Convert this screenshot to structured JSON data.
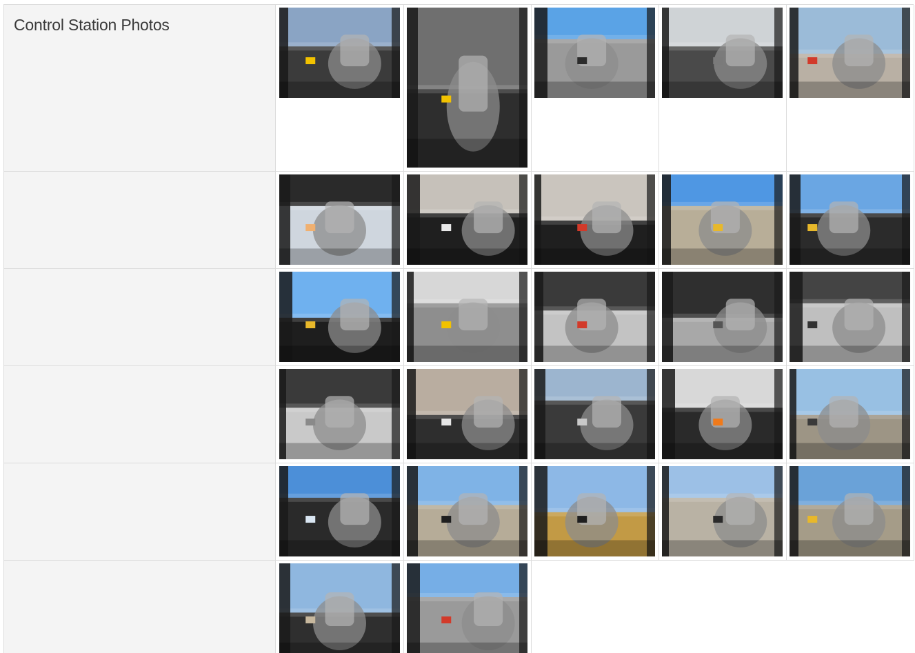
{
  "section": {
    "title": "Control Station Photos"
  },
  "rows": [
    {
      "photos": [
        {
          "icon": "cab-floor-photo",
          "sky": "#8aa4c4",
          "ground": "#3b3b3b",
          "accent": "#f2c200"
        },
        {
          "icon": "cab-floor-pedals-photo",
          "sky": "#6f6f6f",
          "ground": "#2e2e2e",
          "accent": "#f2c200"
        },
        {
          "icon": "operator-seat-photo",
          "sky": "#5aa3e6",
          "ground": "#9a9a9a",
          "accent": "#2b2b2b"
        },
        {
          "icon": "operator-seat-top-photo",
          "sky": "#cfd3d6",
          "ground": "#4a4a4a",
          "accent": "#7a7a7a"
        },
        {
          "icon": "joystick-lever-photo",
          "sky": "#9bbbd8",
          "ground": "#b9b0a4",
          "accent": "#d23a2a"
        }
      ]
    },
    {
      "photos": [
        {
          "icon": "cab-ceiling-light-photo",
          "sky": "#2a2a2a",
          "ground": "#cfd6de",
          "accent": "#f0b070"
        },
        {
          "icon": "ceiling-speaker-photo",
          "sky": "#c6c1ba",
          "ground": "#1f1f1f",
          "accent": "#e9e9e9"
        },
        {
          "icon": "ceiling-speaker-photo",
          "sky": "#cac5be",
          "ground": "#1f1f1f",
          "accent": "#d23a2a"
        },
        {
          "icon": "rear-window-view-photo",
          "sky": "#4f97e3",
          "ground": "#b8ae98",
          "accent": "#e8b82a"
        },
        {
          "icon": "rear-window-view-photo",
          "sky": "#6aa6e3",
          "ground": "#2b2b2b",
          "accent": "#e8b82a"
        }
      ]
    },
    {
      "photos": [
        {
          "icon": "front-window-view-photo",
          "sky": "#6fb1ef",
          "ground": "#1e1e1e",
          "accent": "#e8b82a"
        },
        {
          "icon": "climate-control-panel-photo",
          "sky": "#d7d7d7",
          "ground": "#8e8e8e",
          "accent": "#f2c200"
        },
        {
          "icon": "right-console-photo",
          "sky": "#3a3a3a",
          "ground": "#c3c3c3",
          "accent": "#d23a2a"
        },
        {
          "icon": "shift-lever-photo",
          "sky": "#2f2f2f",
          "ground": "#a8a8a8",
          "accent": "#555555"
        },
        {
          "icon": "joystick-console-photo",
          "sky": "#444444",
          "ground": "#bfbfbf",
          "accent": "#333333"
        }
      ]
    },
    {
      "photos": [
        {
          "icon": "cup-holder-photo",
          "sky": "#3a3a3a",
          "ground": "#c9c9c9",
          "accent": "#8a8a8a"
        },
        {
          "icon": "air-vent-photo",
          "sky": "#b9ada0",
          "ground": "#2e2e2e",
          "accent": "#e6e6e6"
        },
        {
          "icon": "display-monitor-photo",
          "sky": "#9cb5cf",
          "ground": "#3a3a3a",
          "accent": "#c9c9c9"
        },
        {
          "icon": "display-monitor-photo",
          "sky": "#d8d8d8",
          "ground": "#2a2a2a",
          "accent": "#f07a1a"
        },
        {
          "icon": "rear-vent-photo",
          "sky": "#98c0e3",
          "ground": "#9d9585",
          "accent": "#3a3a3a"
        }
      ]
    },
    {
      "photos": [
        {
          "icon": "roof-window-photo",
          "sky": "#4c8fd8",
          "ground": "#2a2a2a",
          "accent": "#d9e6f2"
        },
        {
          "icon": "side-window-photo",
          "sky": "#7fb3e6",
          "ground": "#b6ac98",
          "accent": "#1f1f1f"
        },
        {
          "icon": "side-window-photo",
          "sky": "#8db8e6",
          "ground": "#c29a45",
          "accent": "#1f1f1f"
        },
        {
          "icon": "side-mirror-view-photo",
          "sky": "#9cc0e6",
          "ground": "#b9b2a4",
          "accent": "#2a2a2a"
        },
        {
          "icon": "rear-window-view-photo",
          "sky": "#6aa2d8",
          "ground": "#a59c88",
          "accent": "#e8b82a"
        }
      ]
    },
    {
      "photos": [
        {
          "icon": "front-cab-view-photo",
          "sky": "#8fb7df",
          "ground": "#2f2f2f",
          "accent": "#c7b89e"
        },
        {
          "icon": "seat-dashboard-view-photo",
          "sky": "#76aee6",
          "ground": "#9a9a9a",
          "accent": "#d23a2a"
        }
      ]
    }
  ]
}
